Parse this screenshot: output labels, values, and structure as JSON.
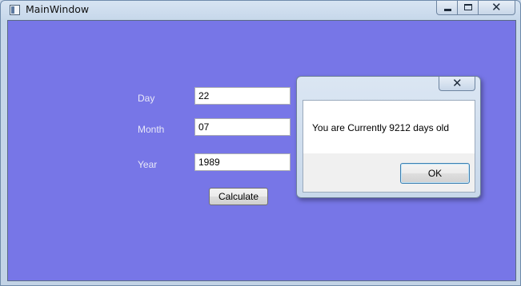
{
  "window": {
    "title": "MainWindow",
    "caption_icons": [
      "minimize-icon",
      "maximize-icon",
      "close-icon"
    ],
    "background_color": "#7776e7"
  },
  "form": {
    "day_label": "Day",
    "day_value": "22",
    "month_label": "Month",
    "month_value": "07",
    "year_label": "Year",
    "year_value": "1989",
    "calculate_label": "Calculate"
  },
  "dialog": {
    "message": "You are Currently 9212 days old",
    "ok_label": "OK"
  }
}
